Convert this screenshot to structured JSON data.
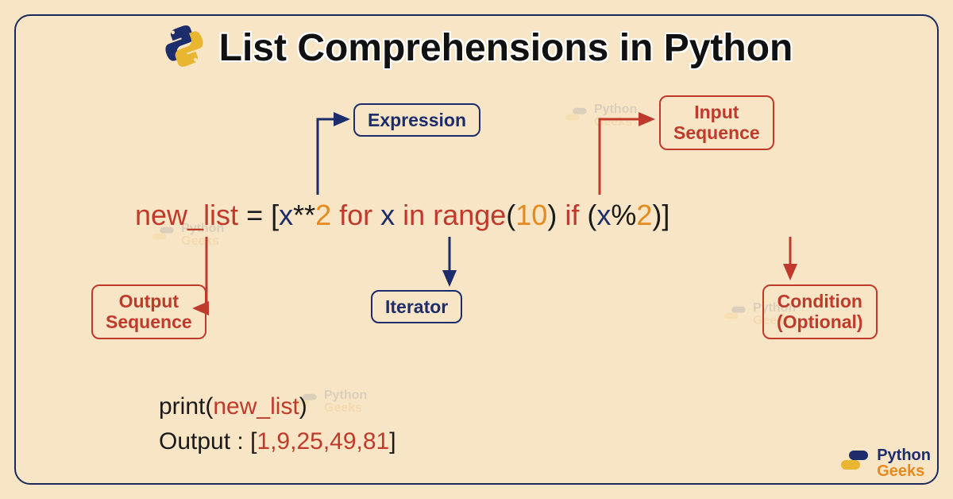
{
  "title": "List Comprehensions in Python",
  "labels": {
    "expression": "Expression",
    "input_seq_l1": "Input",
    "input_seq_l2": "Sequence",
    "output_seq_l1": "Output",
    "output_seq_l2": "Sequence",
    "iterator": "Iterator",
    "condition_l1": "Condition",
    "condition_l2": "(Optional)"
  },
  "code": {
    "t1": "new_list",
    "t2": " = [",
    "t3": "x",
    "t4": "**",
    "t5": "2",
    "t6": " for ",
    "t7": "x",
    "t8": " in ",
    "t9": "range",
    "t10": "(",
    "t11": "10",
    "t12": ") ",
    "t13": "if",
    "t14": " (",
    "t15": "x",
    "t16": "%",
    "t17": "2",
    "t18": ")]"
  },
  "print": {
    "p1a": "print(",
    "p1b": "new_list",
    "p1c": ")",
    "p2a": "Output : [",
    "p2b": "1,9,25,49,81",
    "p2c": "]"
  },
  "brand": {
    "line1": "Python",
    "line2": "Geeks"
  },
  "colors": {
    "red": "#c03a2b",
    "navy": "#1d2d6b",
    "orange": "#e58a1f",
    "bg": "#f7e5c6"
  }
}
